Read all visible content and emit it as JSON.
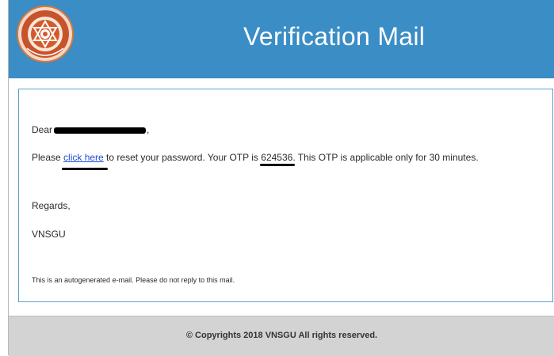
{
  "header": {
    "title": "Verification Mail",
    "logo_icon": "vnsgu-emblem-icon",
    "bg_color": "#3a8dc5"
  },
  "mail": {
    "greeting_prefix": "Dear",
    "greeting_suffix": ",",
    "line_prefix": "Please ",
    "link_text": "click here",
    "line_mid": " to reset your password. Your OTP is ",
    "otp": "624536",
    "line_suffix": ". This OTP is applicable only for 30 minutes.",
    "regards": "Regards,",
    "signature": "VNSGU",
    "autogen_note": "This is an autogenerated e-mail. Please do not reply to this mail."
  },
  "footer": {
    "copyright": "© Copyrights 2018 VNSGU All rights reserved."
  }
}
